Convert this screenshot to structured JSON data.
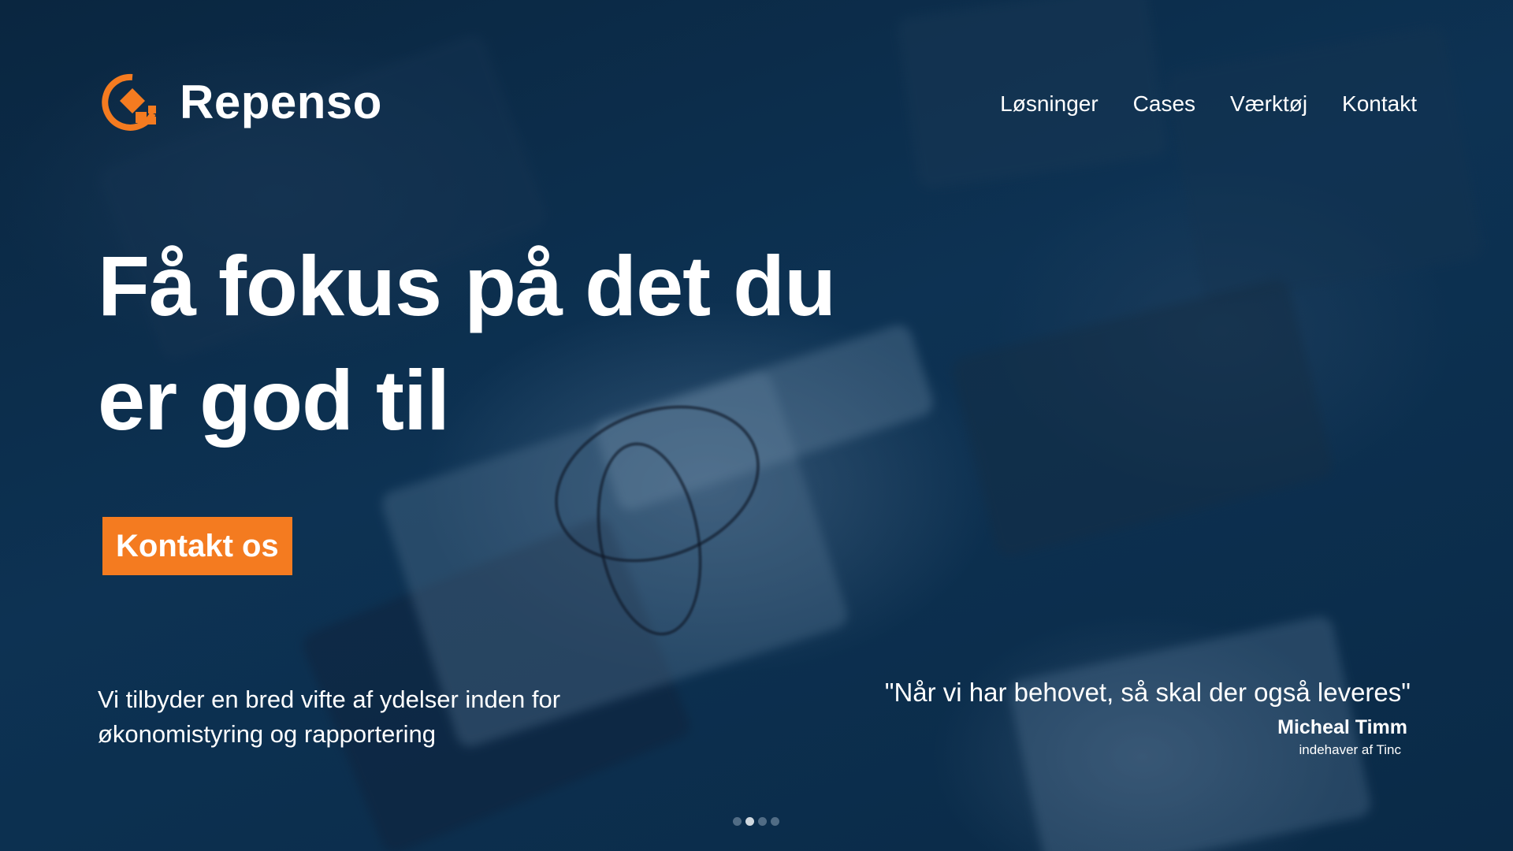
{
  "brand": {
    "name": "Repenso",
    "accent_color": "#f47b20"
  },
  "nav": {
    "items": [
      {
        "label": "Løsninger"
      },
      {
        "label": "Cases"
      },
      {
        "label": "Værktøj"
      },
      {
        "label": "Kontakt"
      }
    ]
  },
  "hero": {
    "headline_line1": "Få fokus på det du",
    "headline_line2": "er god til",
    "cta_label": "Kontakt os",
    "subtext_line1": "Vi tilbyder en bred vifte af ydelser inden for",
    "subtext_line2": "økonomistyring og rapportering"
  },
  "testimonial": {
    "quote": "\"Når vi har behovet, så skal der også leveres\"",
    "author": "Micheal Timm",
    "role": "indehaver af Tinc"
  },
  "carousel": {
    "slide_count": 4,
    "active_index": 1
  }
}
